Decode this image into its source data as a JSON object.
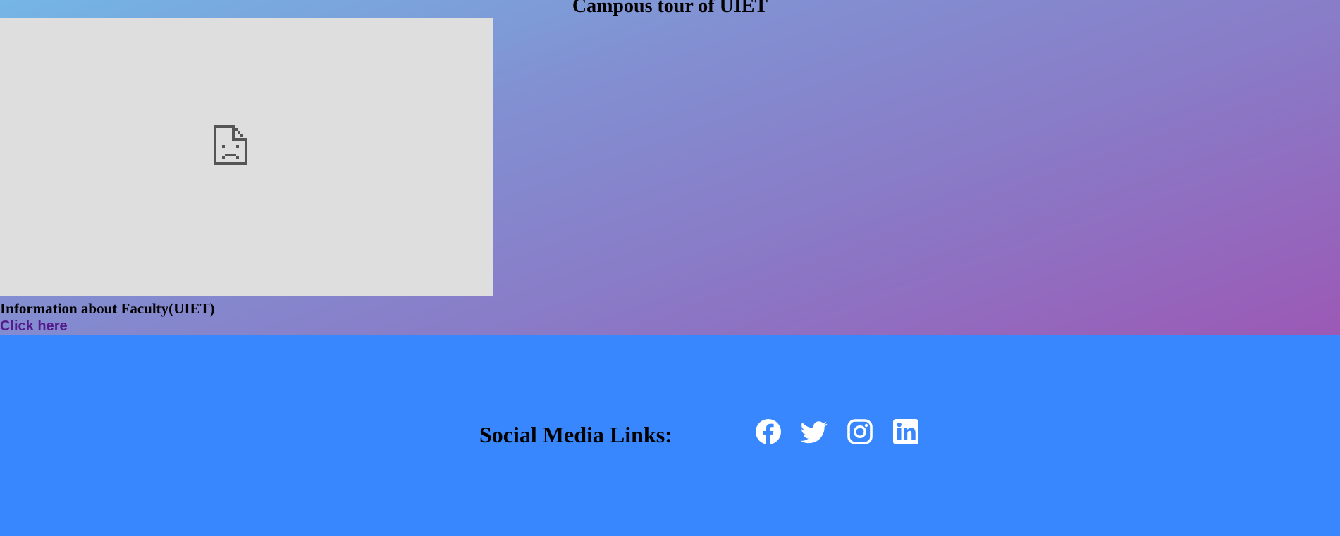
{
  "header": {
    "title": "Campous tour of UIET"
  },
  "video": {
    "icon": "broken-page-icon",
    "placeholder_color": "#dedede"
  },
  "faculty": {
    "heading": "Information about Faculty(UIET)",
    "link_label": "Click here"
  },
  "footer": {
    "label": "Social Media Links:",
    "background": "#3887fe",
    "icons": [
      "facebook-icon",
      "twitter-icon",
      "instagram-icon",
      "linkedin-icon"
    ]
  },
  "colors": {
    "gradient_start": "#74b6e6",
    "gradient_end": "#9b59b6",
    "link_visited": "#551a8b"
  }
}
